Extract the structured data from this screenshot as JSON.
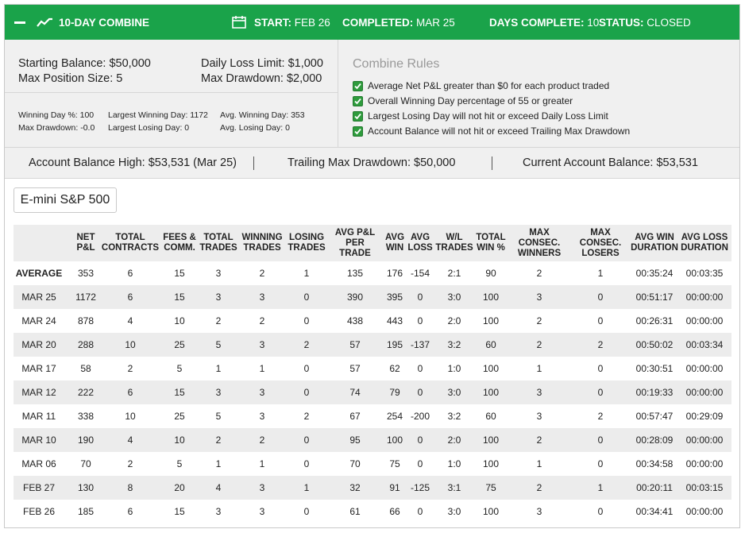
{
  "header": {
    "title": "10-DAY COMBINE",
    "start_label": "START:",
    "start_value": "FEB 26",
    "completed_label": "COMPLETED:",
    "completed_value": "MAR 25",
    "days_label": "DAYS COMPLETE:",
    "days_value": "10",
    "status_label": "STATUS:",
    "status_value": "CLOSED",
    "bg_color": "#1aa34a"
  },
  "account": {
    "starting_balance": "Starting Balance: $50,000",
    "max_position": "Max Position Size: 5",
    "daily_loss_limit": "Daily Loss Limit: $1,000",
    "max_drawdown": "Max Drawdown: $2,000"
  },
  "stats": {
    "winning_day_pct": "Winning Day %: 100",
    "max_drawdown": "Max Drawdown: -0.0",
    "largest_winning_day": "Largest Winning Day: 1172",
    "largest_losing_day": "Largest Losing Day: 0",
    "avg_winning_day": "Avg. Winning Day: 353",
    "avg_losing_day": "Avg. Losing Day: 0"
  },
  "rules": {
    "title": "Combine Rules",
    "items": [
      "Average Net P&L greater than $0 for each product traded",
      "Overall Winning Day percentage of 55 or greater",
      "Largest Losing Day will not hit or exceed Daily Loss Limit",
      "Account Balance will not hit or exceed Trailing Max Drawdown"
    ],
    "check_color": "#2e9b3c"
  },
  "balances": {
    "high_label": "Account Balance High:",
    "high_value": "$53,531 (Mar 25)",
    "trailing_label": "Trailing Max Drawdown:",
    "trailing_value": "$50,000",
    "current_label": "Current Account Balance:",
    "current_value": "$53,531"
  },
  "product": "E-mini S&P 500",
  "table": {
    "headers": [
      [
        "",
        ""
      ],
      [
        "NET",
        "P&L"
      ],
      [
        "TOTAL",
        "CONTRACTS"
      ],
      [
        "FEES &",
        "COMM."
      ],
      [
        "TOTAL",
        "TRADES"
      ],
      [
        "WINNING",
        "TRADES"
      ],
      [
        "LOSING",
        "TRADES"
      ],
      [
        "AVG P&L",
        "PER",
        "TRADE"
      ],
      [
        "AVG",
        "WIN"
      ],
      [
        "AVG",
        "LOSS"
      ],
      [
        "W/L",
        "TRADES"
      ],
      [
        "TOTAL",
        "WIN %"
      ],
      [
        "MAX",
        "CONSEC.",
        "WINNERS"
      ],
      [
        "MAX",
        "CONSEC.",
        "LOSERS"
      ],
      [
        "AVG WIN",
        "DURATION"
      ],
      [
        "AVG LOSS",
        "DURATION"
      ]
    ],
    "rows": [
      [
        "AVERAGE",
        "353",
        "6",
        "15",
        "3",
        "2",
        "1",
        "135",
        "176",
        "-154",
        "2:1",
        "90",
        "2",
        "1",
        "00:35:24",
        "00:03:35"
      ],
      [
        "MAR 25",
        "1172",
        "6",
        "15",
        "3",
        "3",
        "0",
        "390",
        "395",
        "0",
        "3:0",
        "100",
        "3",
        "0",
        "00:51:17",
        "00:00:00"
      ],
      [
        "MAR 24",
        "878",
        "4",
        "10",
        "2",
        "2",
        "0",
        "438",
        "443",
        "0",
        "2:0",
        "100",
        "2",
        "0",
        "00:26:31",
        "00:00:00"
      ],
      [
        "MAR 20",
        "288",
        "10",
        "25",
        "5",
        "3",
        "2",
        "57",
        "195",
        "-137",
        "3:2",
        "60",
        "2",
        "2",
        "00:50:02",
        "00:03:34"
      ],
      [
        "MAR 17",
        "58",
        "2",
        "5",
        "1",
        "1",
        "0",
        "57",
        "62",
        "0",
        "1:0",
        "100",
        "1",
        "0",
        "00:30:51",
        "00:00:00"
      ],
      [
        "MAR 12",
        "222",
        "6",
        "15",
        "3",
        "3",
        "0",
        "74",
        "79",
        "0",
        "3:0",
        "100",
        "3",
        "0",
        "00:19:33",
        "00:00:00"
      ],
      [
        "MAR 11",
        "338",
        "10",
        "25",
        "5",
        "3",
        "2",
        "67",
        "254",
        "-200",
        "3:2",
        "60",
        "3",
        "2",
        "00:57:47",
        "00:29:09"
      ],
      [
        "MAR 10",
        "190",
        "4",
        "10",
        "2",
        "2",
        "0",
        "95",
        "100",
        "0",
        "2:0",
        "100",
        "2",
        "0",
        "00:28:09",
        "00:00:00"
      ],
      [
        "MAR 06",
        "70",
        "2",
        "5",
        "1",
        "1",
        "0",
        "70",
        "75",
        "0",
        "1:0",
        "100",
        "1",
        "0",
        "00:34:58",
        "00:00:00"
      ],
      [
        "FEB 27",
        "130",
        "8",
        "20",
        "4",
        "3",
        "1",
        "32",
        "91",
        "-125",
        "3:1",
        "75",
        "2",
        "1",
        "00:20:11",
        "00:03:15"
      ],
      [
        "FEB 26",
        "185",
        "6",
        "15",
        "3",
        "3",
        "0",
        "61",
        "66",
        "0",
        "3:0",
        "100",
        "3",
        "0",
        "00:34:41",
        "00:00:00"
      ]
    ]
  }
}
